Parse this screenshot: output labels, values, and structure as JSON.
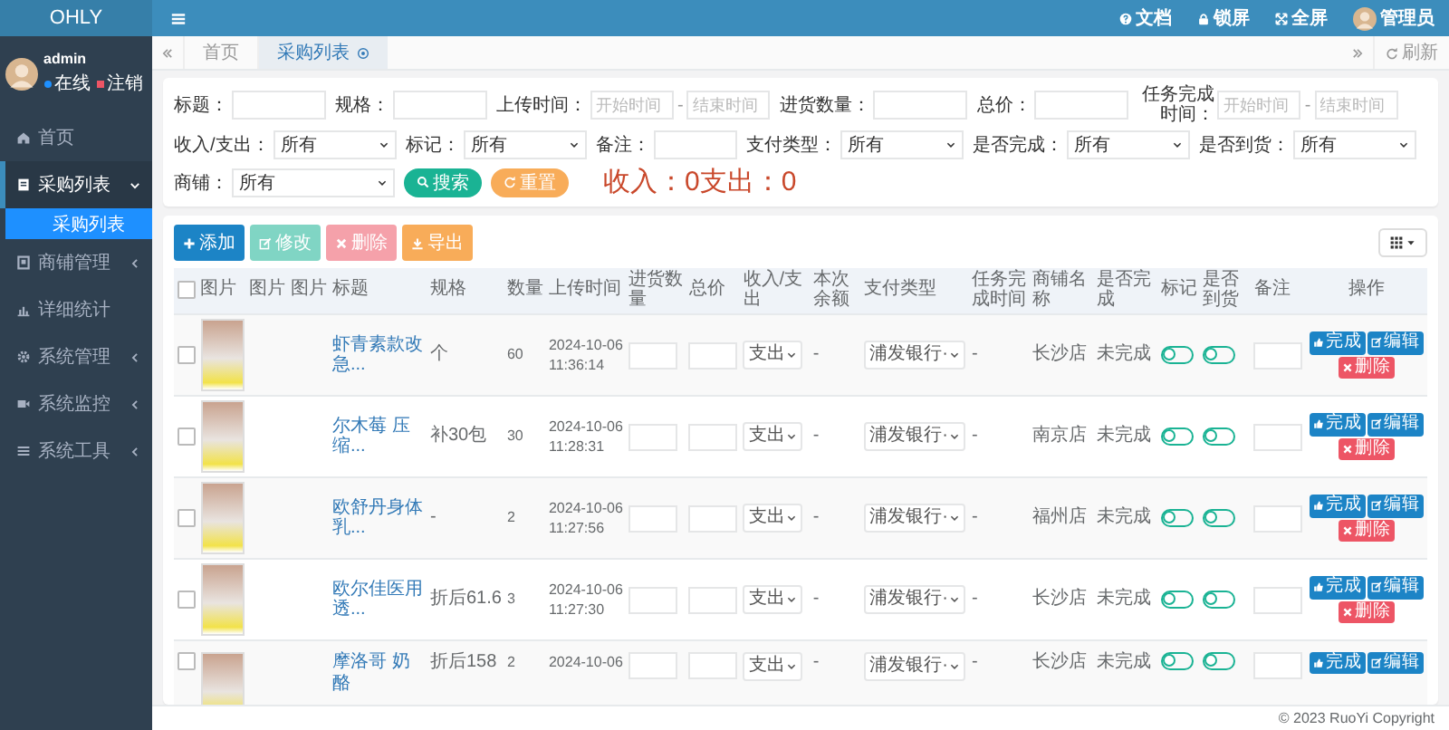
{
  "sidebar": {
    "logo": "OHLY",
    "user": {
      "name": "admin",
      "status": "在线",
      "logout": "注销"
    },
    "items": [
      {
        "label": "首页",
        "selected": false
      },
      {
        "label": "采购列表",
        "selected": true,
        "expanded": true,
        "children": [
          {
            "label": "采购列表",
            "selected": true
          }
        ]
      },
      {
        "label": "商铺管理",
        "selected": false,
        "expanded": false
      },
      {
        "label": "详细统计",
        "selected": false
      },
      {
        "label": "系统管理",
        "selected": false,
        "expanded": false
      },
      {
        "label": "系统监控",
        "selected": false,
        "expanded": false
      },
      {
        "label": "系统工具",
        "selected": false,
        "expanded": false
      }
    ]
  },
  "header": {
    "links": [
      "文档",
      "锁屏",
      "全屏"
    ],
    "user": "管理员"
  },
  "tabs": {
    "items": [
      {
        "label": "首页",
        "selected": false
      },
      {
        "label": "采购列表",
        "selected": true
      }
    ],
    "refresh": "刷新"
  },
  "filters": {
    "rows": [
      [
        {
          "kind": "text",
          "label": "标题："
        },
        {
          "kind": "text",
          "label": "规格："
        },
        {
          "kind": "daterange",
          "label": "上传时间：",
          "start_placeholder": "开始时间",
          "separator": "-",
          "end_placeholder": "结束时间"
        },
        {
          "kind": "text",
          "label": "进货数量："
        },
        {
          "kind": "text",
          "label": "总价："
        },
        {
          "kind": "daterange",
          "label": "任务完成时间：",
          "start_placeholder": "开始时间",
          "separator": "-",
          "end_placeholder": "结束时间"
        }
      ],
      [
        {
          "kind": "select",
          "label": "收入/支出：",
          "value": "所有"
        },
        {
          "kind": "select",
          "label": "标记：",
          "value": "所有"
        },
        {
          "kind": "text",
          "label": "备注："
        },
        {
          "kind": "select",
          "label": "支付类型：",
          "value": "所有"
        },
        {
          "kind": "select",
          "label": "是否完成：",
          "value": "所有"
        },
        {
          "kind": "select",
          "label": "是否到货：",
          "value": "所有"
        }
      ],
      [
        {
          "kind": "select",
          "label": "商铺：",
          "value": "所有"
        }
      ]
    ],
    "buttons": [
      "搜索",
      "重置"
    ],
    "summary": "收入：0支出：0"
  },
  "table": {
    "toolbar": [
      {
        "label": "添加",
        "disabled": false
      },
      {
        "label": "修改",
        "disabled": true
      },
      {
        "label": "删除",
        "disabled": true
      },
      {
        "label": "导出",
        "disabled": false
      }
    ],
    "columns": [
      "图片",
      "图片",
      "图片",
      "标题",
      "规格",
      "数量",
      "上传时间",
      "进货数量",
      "总价",
      "收入/支出",
      "本次余额",
      "支付类型",
      "任务完成时间",
      "商铺名称",
      "是否完成",
      "标记",
      "是否到货",
      "备注",
      "操作"
    ],
    "all_checked": false,
    "rows": [
      {
        "checked": false,
        "title": "虾青素款改急...",
        "spec": "个",
        "qty": "60",
        "date": "2024-10-06",
        "time": "11:36:14",
        "flow": "支出",
        "balance": "-",
        "pay_type": "浦发银行·",
        "done_time": "-",
        "shop": "长沙店",
        "status": "未完成",
        "marked": false,
        "arrived": false,
        "actions": [
          "完成",
          "编辑",
          "删除"
        ]
      },
      {
        "checked": false,
        "title": "尔木莓 压缩...",
        "spec": "补30包",
        "qty": "30",
        "date": "2024-10-06",
        "time": "11:28:31",
        "flow": "支出",
        "balance": "-",
        "pay_type": "浦发银行·",
        "done_time": "-",
        "shop": "南京店",
        "status": "未完成",
        "marked": false,
        "arrived": false,
        "actions": [
          "完成",
          "编辑",
          "删除"
        ]
      },
      {
        "checked": false,
        "title": "欧舒丹身体乳...",
        "spec": "-",
        "qty": "2",
        "date": "2024-10-06",
        "time": "11:27:56",
        "flow": "支出",
        "balance": "-",
        "pay_type": "浦发银行·",
        "done_time": "-",
        "shop": "福州店",
        "status": "未完成",
        "marked": false,
        "arrived": false,
        "actions": [
          "完成",
          "编辑",
          "删除"
        ]
      },
      {
        "checked": false,
        "title": "欧尔佳医用透...",
        "spec": "折后61.6",
        "qty": "3",
        "date": "2024-10-06",
        "time": "11:27:30",
        "flow": "支出",
        "balance": "-",
        "pay_type": "浦发银行·",
        "done_time": "-",
        "shop": "长沙店",
        "status": "未完成",
        "marked": false,
        "arrived": false,
        "actions": [
          "完成",
          "编辑",
          "删除"
        ]
      },
      {
        "checked": false,
        "title": "摩洛哥 奶酪",
        "spec": "折后158",
        "qty": "2",
        "date": "2024-10-06",
        "flow": "支出",
        "balance": "-",
        "pay_type": "浦发银行·",
        "done_time": "-",
        "shop": "长沙店",
        "status": "未完成",
        "marked": false,
        "arrived": false,
        "actions": [
          "完成",
          "编辑"
        ]
      }
    ]
  },
  "footer": "© 2023 RuoYi Copyright"
}
